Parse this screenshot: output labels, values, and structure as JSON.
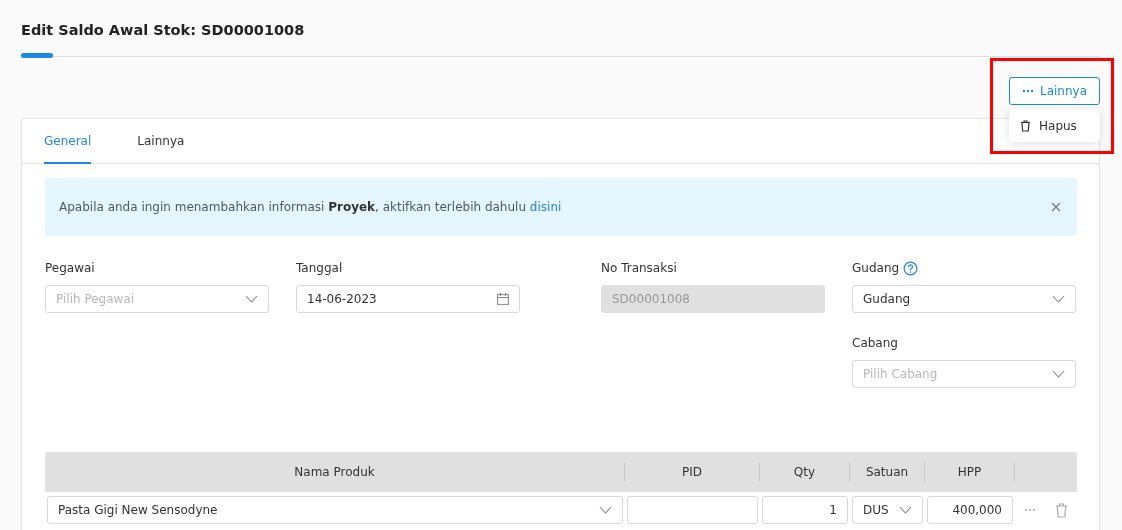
{
  "page": {
    "title": "Edit Saldo Awal Stok: SD00001008"
  },
  "actions": {
    "more_button": {
      "label": "Lainnya"
    },
    "menu": {
      "open": true,
      "items": [
        {
          "label": "Hapus"
        }
      ]
    },
    "highlighted": true
  },
  "tabs": [
    {
      "label": "General",
      "selected": true
    },
    {
      "label": "Lainnya",
      "selected": false
    }
  ],
  "alert": {
    "text": "Apabila anda ingin menambahkan informasi **Proyek**, aktifkan terlebih dahulu",
    "link": "disini"
  },
  "form": {
    "columns": [
      [
        {
          "label": "Pegawai",
          "kind": "select",
          "placeholder": "Pilih Pegawai"
        }
      ],
      [
        {
          "label": "Tanggal",
          "kind": "date",
          "value": "14-06-2023"
        }
      ],
      [
        {
          "label": "No Transaksi",
          "kind": "text",
          "value": "SD00001008",
          "disabled": true
        }
      ],
      [
        {
          "label": "Gudang",
          "kind": "select",
          "value": "Gudang",
          "help": true
        },
        {
          "label": "Cabang",
          "kind": "select",
          "placeholder": "Pilih Cabang"
        }
      ]
    ]
  },
  "table": {
    "columns": [
      "Nama Produk",
      "PID",
      "Qty",
      "Satuan",
      "HPP"
    ],
    "rows": [
      {
        "product": "Pasta Gigi New Sensodyne",
        "qty": "1",
        "unit": "DUS",
        "hpp": "400,000"
      }
    ]
  }
}
